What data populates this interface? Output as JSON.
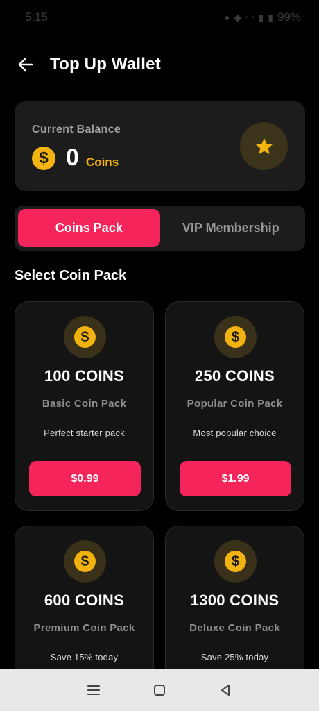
{
  "status_bar": {
    "time": "5:15",
    "battery": "99%"
  },
  "header": {
    "title": "Top Up Wallet",
    "back_icon": "arrow-left-icon"
  },
  "balance": {
    "label": "Current Balance",
    "amount": "0",
    "unit": "Coins",
    "coin_symbol": "$",
    "badge_icon": "star-icon"
  },
  "tabs": [
    {
      "label": "Coins Pack",
      "active": true
    },
    {
      "label": "VIP Membership",
      "active": false
    }
  ],
  "section": {
    "title": "Select Coin Pack"
  },
  "packs": [
    {
      "coins": "100 COINS",
      "name": "Basic Coin Pack",
      "desc": "Perfect starter pack",
      "price": "$0.99",
      "symbol": "$"
    },
    {
      "coins": "250 COINS",
      "name": "Popular Coin Pack",
      "desc": "Most popular choice",
      "price": "$1.99",
      "symbol": "$"
    },
    {
      "coins": "600 COINS",
      "name": "Premium Coin Pack",
      "desc": "Save 15% today",
      "price": "",
      "symbol": "$"
    },
    {
      "coins": "1300 COINS",
      "name": "Deluxe Coin Pack",
      "desc": "Save 25% today",
      "price": "",
      "symbol": "$"
    }
  ],
  "colors": {
    "accent": "#f5245a",
    "gold": "#f2b20f",
    "background": "#000000",
    "card": "#1c1c1c"
  },
  "nav": [
    "menu-icon",
    "home-square-icon",
    "back-triangle-icon"
  ]
}
